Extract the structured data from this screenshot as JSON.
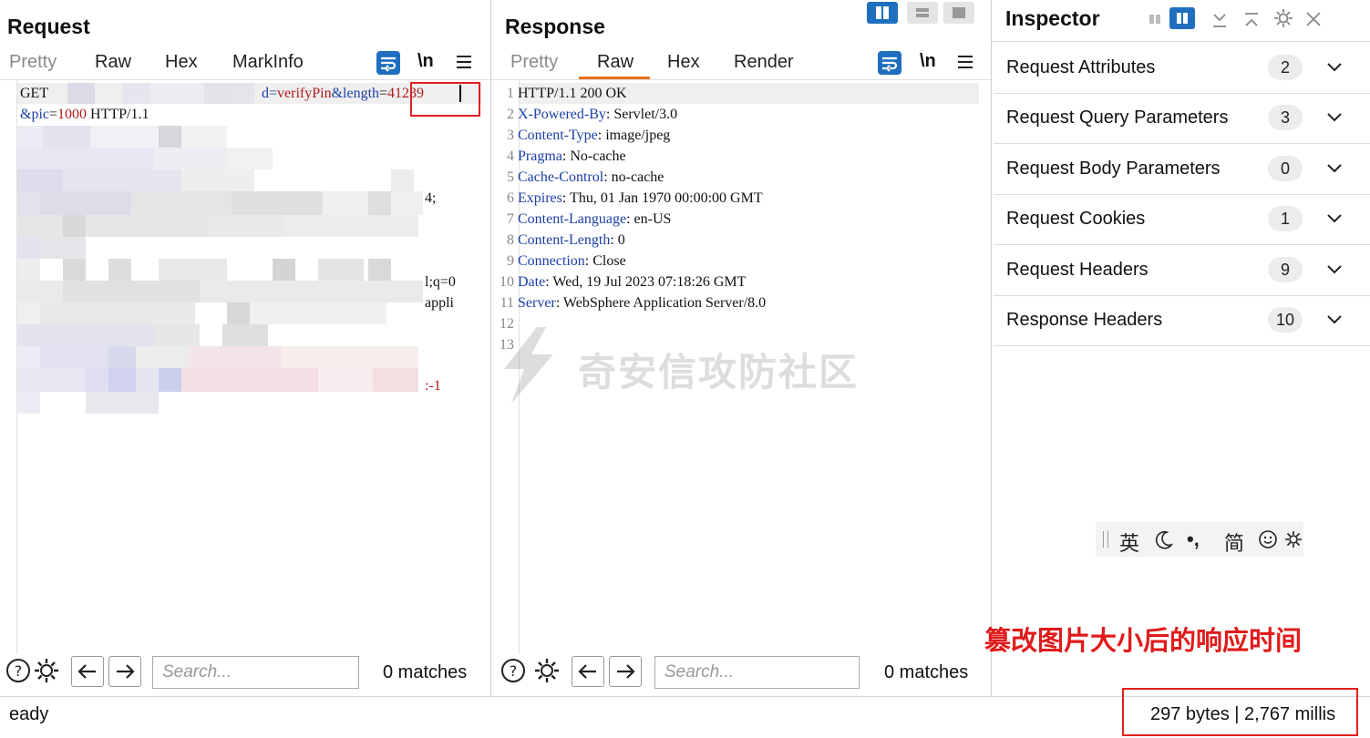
{
  "request": {
    "title": "Request",
    "tabs": [
      "Pretty",
      "Raw",
      "Hex",
      "MarkInfo"
    ],
    "wrap_label": "\\n",
    "line1_prefix": "GET ",
    "line1_param": "d=",
    "line1_value1": "verifyPin",
    "line1_amp": "&length",
    "line1_eq": "=",
    "line1_value2": "41239",
    "line2_param": "&pic",
    "line2_eq": "=",
    "line2_value": "1000",
    "line2_suffix": " HTTP/1.1",
    "frag_1": "4;",
    "frag_2": "l;q=0",
    "frag_3": "appli",
    "frag_4": ":-1",
    "search_placeholder": "Search...",
    "matches": "0 matches"
  },
  "response": {
    "title": "Response",
    "tabs": [
      "Pretty",
      "Raw",
      "Hex",
      "Render"
    ],
    "active_tab": "Raw",
    "wrap_label": "\\n",
    "lines": [
      {
        "n": "1",
        "key": "",
        "val": "HTTP/1.1 200 OK"
      },
      {
        "n": "2",
        "key": "X-Powered-By",
        "val": " Servlet/3.0"
      },
      {
        "n": "3",
        "key": "Content-Type",
        "val": " image/jpeg"
      },
      {
        "n": "4",
        "key": "Pragma",
        "val": " No-cache"
      },
      {
        "n": "5",
        "key": "Cache-Control",
        "val": " no-cache"
      },
      {
        "n": "6",
        "key": "Expires",
        "val": " Thu, 01 Jan 1970 00:00:00 GMT"
      },
      {
        "n": "7",
        "key": "Content-Language",
        "val": " en-US"
      },
      {
        "n": "8",
        "key": "Content-Length",
        "val": " 0"
      },
      {
        "n": "9",
        "key": "Connection",
        "val": " Close"
      },
      {
        "n": "10",
        "key": "Date",
        "val": " Wed, 19 Jul 2023 07:18:26 GMT"
      },
      {
        "n": "11",
        "key": "Server",
        "val": " WebSphere Application Server/8.0"
      },
      {
        "n": "12",
        "key": "",
        "val": ""
      },
      {
        "n": "13",
        "key": "",
        "val": ""
      }
    ],
    "search_placeholder": "Search...",
    "matches": "0 matches"
  },
  "inspector": {
    "title": "Inspector",
    "rows": [
      {
        "label": "Request Attributes",
        "count": "2"
      },
      {
        "label": "Request Query Parameters",
        "count": "3"
      },
      {
        "label": "Request Body Parameters",
        "count": "0"
      },
      {
        "label": "Request Cookies",
        "count": "1"
      },
      {
        "label": "Request Headers",
        "count": "9"
      },
      {
        "label": "Response Headers",
        "count": "10"
      }
    ]
  },
  "ime_toolbar": {
    "lang": "英",
    "mode": "简"
  },
  "watermark": "奇安信攻防社区",
  "annotation": "篡改图片大小后的响应时间",
  "status": {
    "left": "eady",
    "right": "297 bytes | 2,767 millis"
  },
  "colors": {
    "accent": "#1f6fbf",
    "annotation": "#e01b1b",
    "highlight_box": "#e02020",
    "key": "#1a3fa6",
    "value": "#b3181c"
  }
}
